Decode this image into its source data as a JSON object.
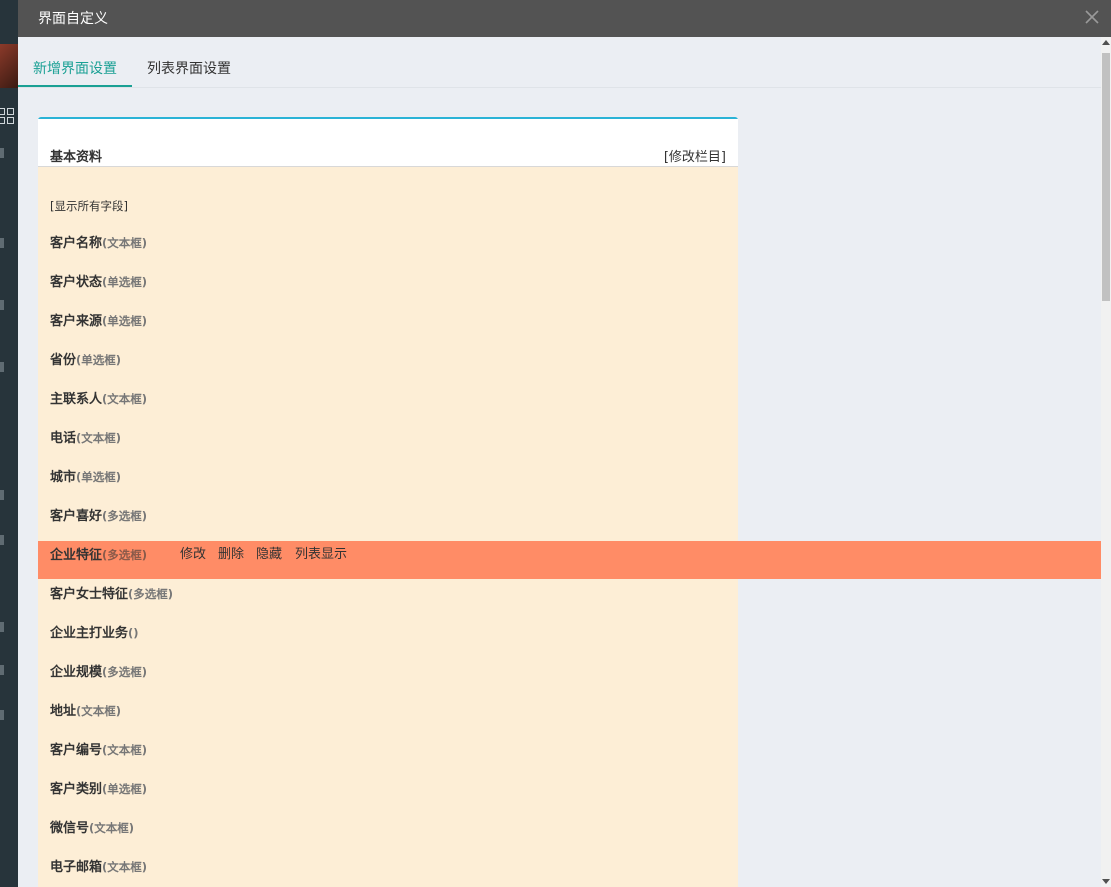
{
  "modal": {
    "title": "界面自定义"
  },
  "tabs": [
    {
      "label": "新增界面设置",
      "active": true
    },
    {
      "label": "列表界面设置",
      "active": false
    }
  ],
  "panel": {
    "title": "基本资料",
    "edit_columns": "[修改栏目]",
    "show_all": "[显示所有字段]"
  },
  "fields": [
    {
      "name": "客户名称",
      "type": "(文本框)"
    },
    {
      "name": "客户状态",
      "type": "(单选框)"
    },
    {
      "name": "客户来源",
      "type": "(单选框)"
    },
    {
      "name": "省份",
      "type": "(单选框)"
    },
    {
      "name": "主联系人",
      "type": "(文本框)"
    },
    {
      "name": "电话",
      "type": "(文本框)"
    },
    {
      "name": "城市",
      "type": "(单选框)"
    },
    {
      "name": "客户喜好",
      "type": "(多选框)"
    },
    {
      "name": "企业特征",
      "type": "(多选框)"
    },
    {
      "name": "客户女士特征",
      "type": "(多选框)"
    },
    {
      "name": "企业主打业务",
      "type": "()"
    },
    {
      "name": "企业规模",
      "type": "(多选框)"
    },
    {
      "name": "地址",
      "type": "(文本框)"
    },
    {
      "name": "客户编号",
      "type": "(文本框)"
    },
    {
      "name": "客户类别",
      "type": "(单选框)"
    },
    {
      "name": "微信号",
      "type": "(文本框)"
    },
    {
      "name": "电子邮箱",
      "type": "(文本框)"
    }
  ],
  "highlighted_index": 8,
  "row_actions": {
    "edit": "修改",
    "delete": "删除",
    "hide": "隐藏",
    "list_show": "列表显示"
  },
  "colors": {
    "accent": "#1aa094",
    "panel_top_border": "#2ab3d6",
    "panel_bg": "#fdeed6",
    "highlight": "#ff8c66",
    "header_bg": "#535353"
  }
}
